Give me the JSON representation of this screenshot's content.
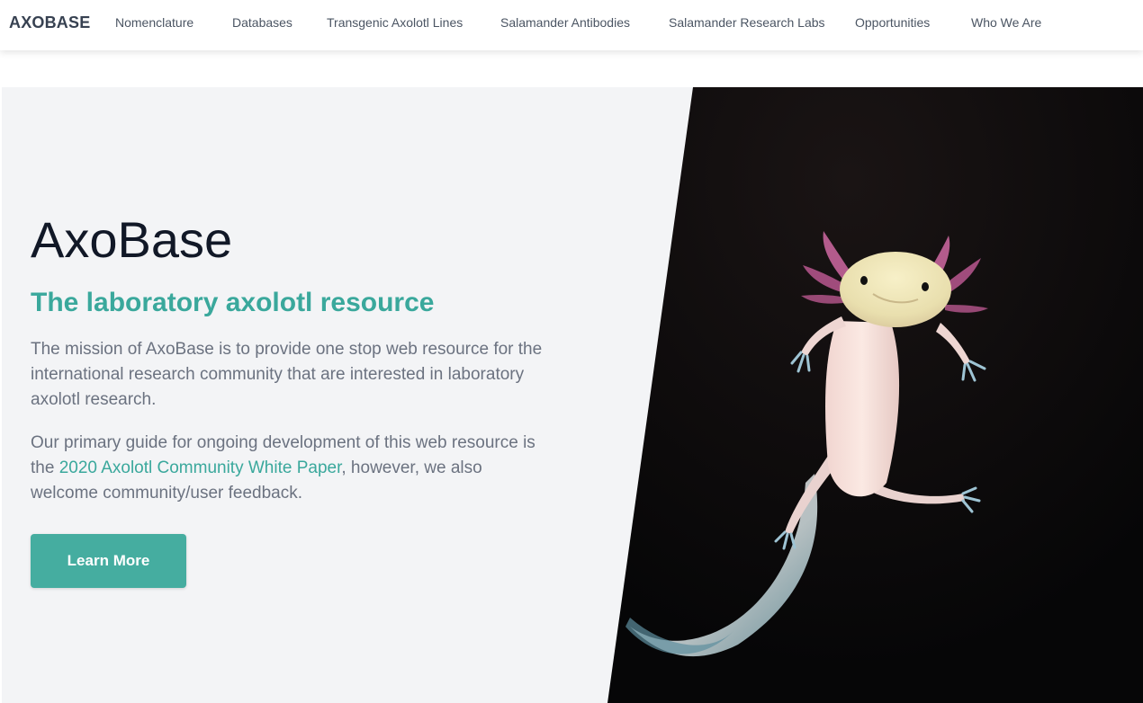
{
  "navbar": {
    "brand": "AXOBASE",
    "links": [
      {
        "label": "Nomenclature"
      },
      {
        "label": "Databases"
      },
      {
        "label": "Transgenic Axolotl Lines"
      },
      {
        "label": "Salamander Antibodies"
      },
      {
        "label": "Salamander Research Labs"
      },
      {
        "label": "Opportunities"
      },
      {
        "label": "Who We Are"
      }
    ]
  },
  "hero": {
    "title": "AxoBase",
    "subtitle": "The laboratory axolotl resource",
    "paragraph1": "The mission of AxoBase is to provide one stop web resource for the international research community that are interested in laboratory axolotl research.",
    "paragraph2_before": "Our primary guide for ongoing development of this web resource is the ",
    "paragraph2_link": "2020 Axolotl Community White Paper",
    "paragraph2_after": ", however, we also welcome community/user feedback.",
    "cta_label": "Learn More",
    "image_subject": "axolotl-photo"
  },
  "colors": {
    "accent": "#45ada0",
    "subtitle": "#3aa89c",
    "title": "#111827",
    "body_text": "#6b7280",
    "hero_bg": "#f3f4f6",
    "photo_bg": "#0b0b0c"
  }
}
